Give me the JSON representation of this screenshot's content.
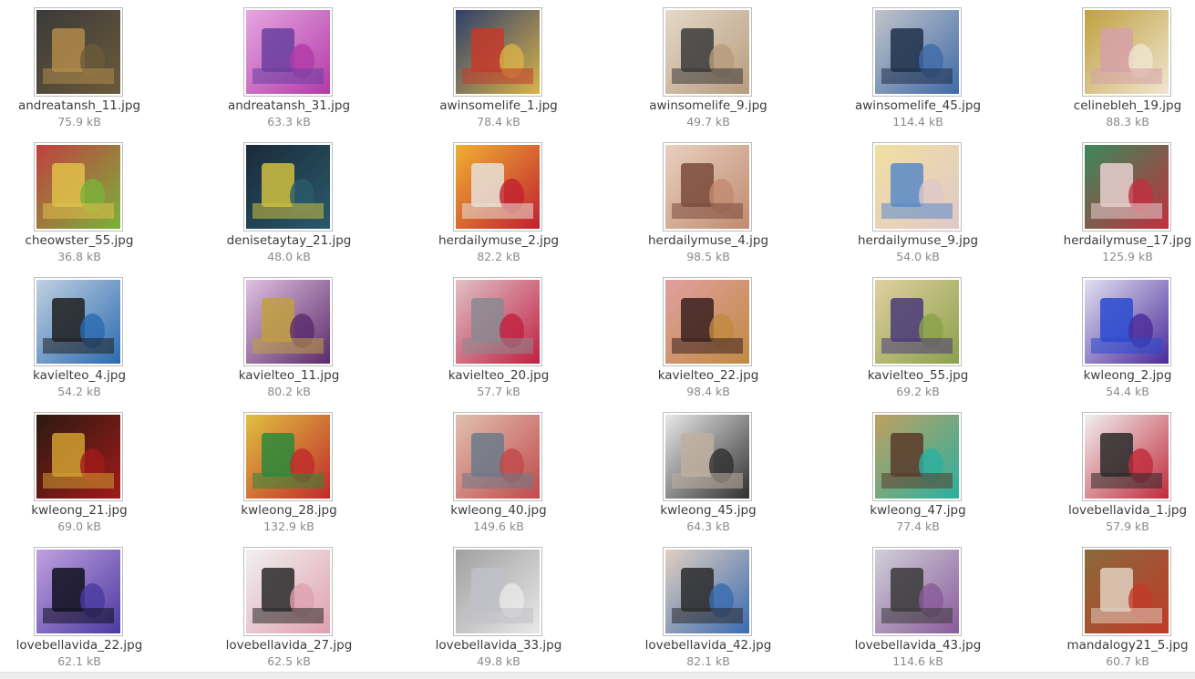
{
  "files": [
    {
      "name": "andreatansh_11.jpg",
      "size": "75.9 kB",
      "colors": [
        "#6b5a3a",
        "#b08a4a",
        "#3a3a3a"
      ]
    },
    {
      "name": "andreatansh_31.jpg",
      "size": "63.3 kB",
      "colors": [
        "#b23aa8",
        "#6a3fa0",
        "#e6a6e0"
      ]
    },
    {
      "name": "awinsomelife_1.jpg",
      "size": "78.4 kB",
      "colors": [
        "#d9b24a",
        "#c43a2a",
        "#2e3f6a"
      ]
    },
    {
      "name": "awinsomelife_9.jpg",
      "size": "49.7 kB",
      "colors": [
        "#b79b7c",
        "#3b3b3b",
        "#e4d9c9"
      ]
    },
    {
      "name": "awinsomelife_45.jpg",
      "size": "114.4 kB",
      "colors": [
        "#3f6aa8",
        "#20304a",
        "#c0c4c9"
      ]
    },
    {
      "name": "celinebleh_19.jpg",
      "size": "88.3 kB",
      "colors": [
        "#f0e6d0",
        "#d6a0a8",
        "#c0a040"
      ]
    },
    {
      "name": "cheowster_55.jpg",
      "size": "36.8 kB",
      "colors": [
        "#7ab23a",
        "#e0c04a",
        "#c04040"
      ]
    },
    {
      "name": "denisetaytay_21.jpg",
      "size": "48.0 kB",
      "colors": [
        "#2a5a6a",
        "#d0c040",
        "#1a2a3a"
      ]
    },
    {
      "name": "herdailymuse_2.jpg",
      "size": "82.2 kB",
      "colors": [
        "#c02030",
        "#e8e0d8",
        "#f0b030"
      ]
    },
    {
      "name": "herdailymuse_4.jpg",
      "size": "98.5 kB",
      "colors": [
        "#c08a70",
        "#7a4a3a",
        "#e8d0c0"
      ]
    },
    {
      "name": "herdailymuse_9.jpg",
      "size": "54.0 kB",
      "colors": [
        "#e0c8c8",
        "#5a8ac8",
        "#f0e0a0"
      ]
    },
    {
      "name": "herdailymuse_17.jpg",
      "size": "125.9 kB",
      "colors": [
        "#c03040",
        "#e8d0d0",
        "#3a8a5a"
      ]
    },
    {
      "name": "kavielteo_4.jpg",
      "size": "54.2 kB",
      "colors": [
        "#2a6ab0",
        "#202020",
        "#c0d0e0"
      ]
    },
    {
      "name": "kavielteo_11.jpg",
      "size": "80.2 kB",
      "colors": [
        "#5a2a6a",
        "#c0a040",
        "#e0c0e0"
      ]
    },
    {
      "name": "kavielteo_20.jpg",
      "size": "57.7 kB",
      "colors": [
        "#c02040",
        "#8a8a90",
        "#e0c0c8"
      ]
    },
    {
      "name": "kavielteo_22.jpg",
      "size": "98.4 kB",
      "colors": [
        "#c08a40",
        "#3a2020",
        "#e0a0a0"
      ]
    },
    {
      "name": "kavielteo_55.jpg",
      "size": "69.2 kB",
      "colors": [
        "#8aa04a",
        "#4a3a7a",
        "#e0d0a0"
      ]
    },
    {
      "name": "kwleong_2.jpg",
      "size": "54.4 kB",
      "colors": [
        "#4a2a9a",
        "#2a4ad0",
        "#e0e0f0"
      ]
    },
    {
      "name": "kwleong_21.jpg",
      "size": "69.0 kB",
      "colors": [
        "#a01a1a",
        "#d0a030",
        "#2a1a10"
      ]
    },
    {
      "name": "kwleong_28.jpg",
      "size": "132.9 kB",
      "colors": [
        "#c02a2a",
        "#2a8a3a",
        "#e0c040"
      ]
    },
    {
      "name": "kwleong_40.jpg",
      "size": "149.6 kB",
      "colors": [
        "#c04a4a",
        "#6a7a8a",
        "#e0c0b0"
      ]
    },
    {
      "name": "kwleong_45.jpg",
      "size": "64.3 kB",
      "colors": [
        "#303030",
        "#c0b0a0",
        "#e8e8e8"
      ]
    },
    {
      "name": "kwleong_47.jpg",
      "size": "77.4 kB",
      "colors": [
        "#2ab0a0",
        "#5a3a2a",
        "#c0a060"
      ]
    },
    {
      "name": "lovebellavida_1.jpg",
      "size": "57.9 kB",
      "colors": [
        "#c02a3a",
        "#2a2a2a",
        "#f0f0f0"
      ]
    },
    {
      "name": "lovebellavida_22.jpg",
      "size": "62.1 kB",
      "colors": [
        "#4a3aa0",
        "#101020",
        "#c0a0e0"
      ]
    },
    {
      "name": "lovebellavida_27.jpg",
      "size": "62.5 kB",
      "colors": [
        "#e0a0b0",
        "#2a2a2a",
        "#f0f0f0"
      ]
    },
    {
      "name": "lovebellavida_33.jpg",
      "size": "49.8 kB",
      "colors": [
        "#e8e8e8",
        "#c0c0c8",
        "#a0a0a0"
      ]
    },
    {
      "name": "lovebellavida_42.jpg",
      "size": "82.1 kB",
      "colors": [
        "#3a6ab0",
        "#2a2a2a",
        "#e0d0c0"
      ]
    },
    {
      "name": "lovebellavida_43.jpg",
      "size": "114.6 kB",
      "colors": [
        "#8a5a9a",
        "#3a3a3a",
        "#d0d0d8"
      ]
    },
    {
      "name": "mandalogy21_5.jpg",
      "size": "60.7 kB",
      "colors": [
        "#c03a2a",
        "#e0d0c0",
        "#8a6a3a"
      ]
    }
  ]
}
